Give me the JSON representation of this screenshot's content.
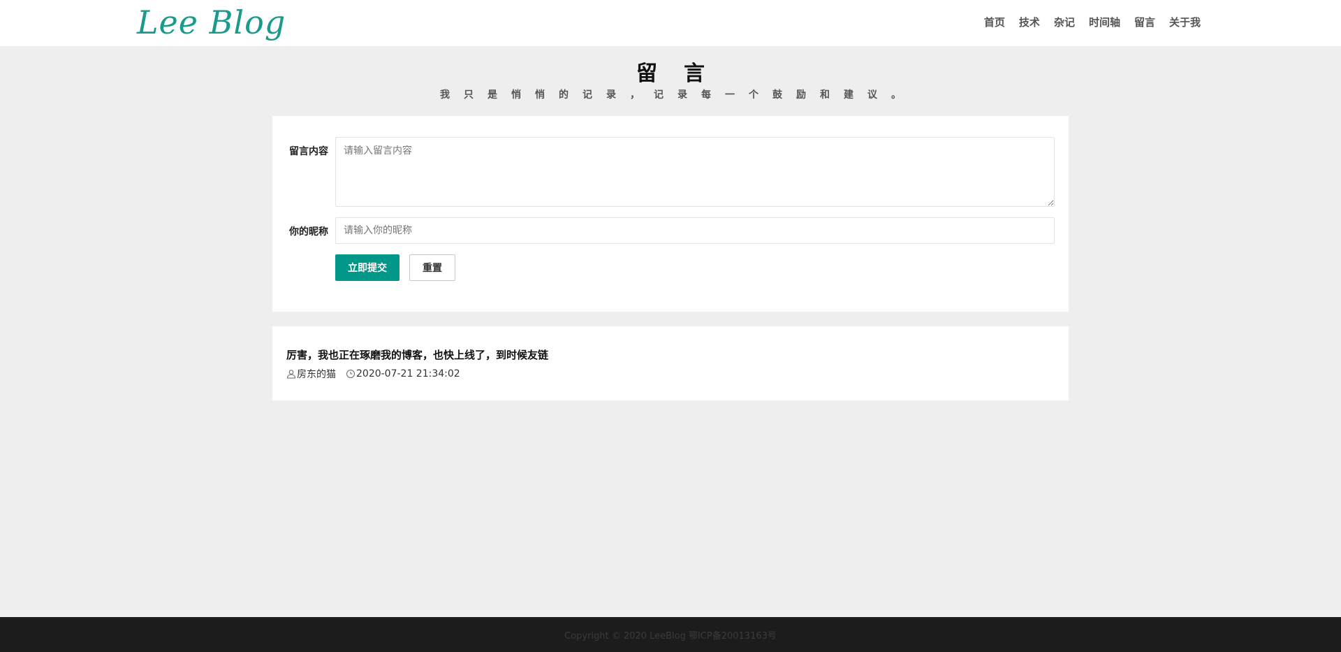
{
  "header": {
    "logo": "Lee Blog",
    "nav": [
      "首页",
      "技术",
      "杂记",
      "时间轴",
      "留言",
      "关于我"
    ]
  },
  "page": {
    "title": "留言",
    "subtitle": "我只是悄悄的记录，记录每一个鼓励和建议。"
  },
  "form": {
    "content_label": "留言内容",
    "content_placeholder": "请输入留言内容",
    "nickname_label": "你的昵称",
    "nickname_placeholder": "请输入你的昵称",
    "submit_label": "立即提交",
    "reset_label": "重置"
  },
  "comments": [
    {
      "text": "厉害，我也正在琢磨我的博客，也快上线了，到时候友链",
      "author": "房东的猫",
      "time": "2020-07-21 21:34:02",
      "author_icon": "user-icon",
      "time_icon": "clock-icon"
    }
  ],
  "footer": {
    "copyright": "Copyright © 2020 LeeBlog 鄂ICP备20013163号"
  },
  "colors": {
    "brand": "#009688",
    "logo": "#1a9a8a",
    "background": "#eeeeee",
    "footer": "#1c1c1c"
  }
}
